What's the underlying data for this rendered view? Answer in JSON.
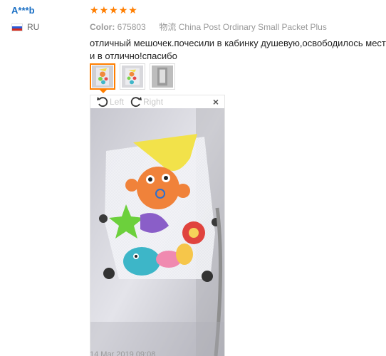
{
  "reviewer": {
    "name": "A***b",
    "country_code": "RU",
    "flag_colors": [
      "#ffffff",
      "#2a5bd7",
      "#d52b1e"
    ]
  },
  "review": {
    "rating": 5,
    "star_color": "#ff7e00",
    "color_label": "Color:",
    "color_value": "675803",
    "shipping_label": "物流",
    "shipping_value": "China Post Ordinary Small Packet Plus",
    "text": "отличный мешочек.почесили в кабинку душевую,освободилось место и в отлично!спасибо",
    "date": "14 Mar 2019 09:08"
  },
  "viewer": {
    "rotate_left_label": "Left",
    "rotate_right_label": "Right",
    "close_label": "×",
    "thumbnails": [
      "photo-1",
      "photo-2",
      "photo-3"
    ]
  }
}
